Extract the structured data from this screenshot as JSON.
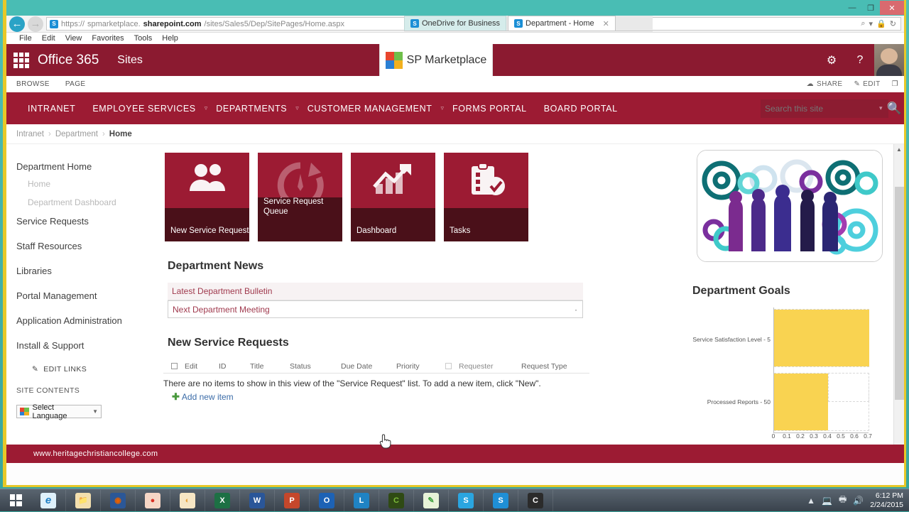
{
  "browser": {
    "url_prefix": "https://",
    "url_host_pre": "spmarketplace.",
    "url_host_bold": "sharepoint.com",
    "url_path": "/sites/Sales5/Dep/SitePages/Home.aspx",
    "sp_icon_letter": "S",
    "tabs": [
      {
        "title": "OneDrive for Business",
        "active": false
      },
      {
        "title": "Department - Home",
        "active": true
      }
    ],
    "menu": [
      "File",
      "Edit",
      "View",
      "Favorites",
      "Tools",
      "Help"
    ],
    "window_controls": {
      "minimize": "—",
      "restore": "❐",
      "close": "✕"
    },
    "addr_icons": {
      "search": "⌕",
      "caret": "▾",
      "lock": "ὑ2",
      "refresh": "↻"
    },
    "tab_close": "✕"
  },
  "suitebar": {
    "waffle_icon": "waffle-icon",
    "office_label": "Office 365",
    "sites_label": "Sites",
    "logo_text": "SP Marketplace",
    "settings_icon": "⚙",
    "help_icon": "?"
  },
  "ribbon": {
    "browse": "BROWSE",
    "page": "PAGE",
    "share": "SHARE",
    "edit": "EDIT",
    "share_icon": "ἱ0",
    "edit_icon": "✎",
    "focus_icon": "❐"
  },
  "topnav": {
    "items": [
      {
        "label": "INTRANET",
        "has_caret": false
      },
      {
        "label": "EMPLOYEE SERVICES",
        "has_caret": true
      },
      {
        "label": "DEPARTMENTS",
        "has_caret": true
      },
      {
        "label": "CUSTOMER MANAGEMENT",
        "has_caret": true
      },
      {
        "label": "FORMS PORTAL",
        "has_caret": false
      },
      {
        "label": "BOARD PORTAL",
        "has_caret": false
      }
    ],
    "caret": "▿",
    "search_placeholder": "Search this site",
    "search_value": "",
    "search_caret": "▾",
    "search_icon": "⌕"
  },
  "breadcrumb": {
    "items": [
      "Intranet",
      "Department"
    ],
    "current": "Home",
    "separator": "›"
  },
  "sidebar": {
    "items": [
      {
        "label": "Department Home",
        "type": "main"
      },
      {
        "label": "Home",
        "type": "sub"
      },
      {
        "label": "Department Dashboard",
        "type": "sub"
      },
      {
        "label": "Service Requests",
        "type": "main"
      },
      {
        "label": "Staff Resources",
        "type": "main"
      },
      {
        "label": "Libraries",
        "type": "main"
      },
      {
        "label": "Portal Management",
        "type": "main"
      },
      {
        "label": "Application Administration",
        "type": "main"
      },
      {
        "label": "Install & Support",
        "type": "main"
      }
    ],
    "edit_links": "EDIT LINKS",
    "edit_links_icon": "✎",
    "site_contents": "SITE CONTENTS",
    "language_label": "Select Language",
    "language_caret": "▼"
  },
  "tiles": [
    {
      "label": "New Service Request",
      "icon": "people-icon",
      "glyph": "👥",
      "style": "normal"
    },
    {
      "label": "Service Request Queue",
      "icon": "refresh-arrow-icon",
      "glyph": "⟳",
      "style": "queue"
    },
    {
      "label": "Dashboard",
      "icon": "bar-chart-arrow-icon",
      "glyph": "📈",
      "style": "normal"
    },
    {
      "label": "Tasks",
      "icon": "clipboard-check-icon",
      "glyph": "📋",
      "style": "normal"
    }
  ],
  "news": {
    "heading": "Department News",
    "items": [
      {
        "title": "Latest Department Bulletin",
        "boxed": false
      },
      {
        "title": "Next Department Meeting",
        "boxed": true
      }
    ],
    "dot": "·"
  },
  "requests": {
    "heading": "New Service Requests",
    "columns": [
      "Edit",
      "ID",
      "Title",
      "Status",
      "Due Date",
      "Priority",
      "Requester",
      "Request Type"
    ],
    "empty_message": "There are no items to show in this view of the \"Service Request\" list. To add a new item, click \"New\".",
    "add_new": "Add new item",
    "add_new_icon": "✦"
  },
  "right": {
    "hero_alt": "business-people-gears-image",
    "goals_heading": "Department Goals"
  },
  "chart_data": {
    "type": "bar",
    "orientation": "horizontal",
    "title": "Department Goals",
    "categories": [
      "Service Satisfaction Level - 5",
      "Processed Reports - 50"
    ],
    "values": [
      0.7,
      0.4
    ],
    "xlabel": "",
    "ylabel": "",
    "xlim": [
      0,
      0.7
    ],
    "xticks": [
      "0",
      "0.1",
      "0.2",
      "0.3",
      "0.4",
      "0.5",
      "0.6",
      "0.7"
    ],
    "bar_color": "#f9d351",
    "grid": true,
    "legend": false
  },
  "footer": {
    "text": "www.heritagechristiancollege.com"
  },
  "taskbar": {
    "start_icon": "windows-logo-icon",
    "apps": [
      {
        "name": "internet-explorer",
        "glyph": "e",
        "color": "#1c7ec4",
        "bg": "#dff1fb"
      },
      {
        "name": "file-explorer",
        "glyph": "🗂",
        "color": "#c8901a",
        "bg": "#f3dfae"
      },
      {
        "name": "firefox",
        "glyph": "◉",
        "color": "#e66000",
        "bg": "#2b5797"
      },
      {
        "name": "chrome",
        "glyph": "●",
        "color": "#d93025",
        "bg": "#f6d6c6"
      },
      {
        "name": "paint",
        "glyph": "🎨",
        "color": "#e8a33d",
        "bg": "#f6e6c4"
      },
      {
        "name": "excel",
        "glyph": "X",
        "color": "#fff",
        "bg": "#1d7044"
      },
      {
        "name": "word",
        "glyph": "W",
        "color": "#fff",
        "bg": "#2a5699"
      },
      {
        "name": "powerpoint",
        "glyph": "P",
        "color": "#fff",
        "bg": "#c5472b"
      },
      {
        "name": "outlook",
        "glyph": "O",
        "color": "#fff",
        "bg": "#1d62b5"
      },
      {
        "name": "lync",
        "glyph": "L",
        "color": "#fff",
        "bg": "#1f83c4"
      },
      {
        "name": "camtasia",
        "glyph": "C",
        "color": "#7dbb3a",
        "bg": "#2f4a14"
      },
      {
        "name": "snagit-editor",
        "glyph": "✎",
        "color": "#3fa13f",
        "bg": "#e8f3d8"
      },
      {
        "name": "skype",
        "glyph": "S",
        "color": "#fff",
        "bg": "#2aa5e0"
      },
      {
        "name": "snagit",
        "glyph": "S",
        "color": "#fff",
        "bg": "#1f8fd6"
      },
      {
        "name": "camtasia-studio",
        "glyph": "C",
        "color": "#fff",
        "bg": "#2b2b2b"
      }
    ],
    "tray_icons": [
      "▲",
      "🔊",
      "🖧",
      "💬"
    ],
    "time": "6:12 PM",
    "date": "2/24/2015"
  }
}
